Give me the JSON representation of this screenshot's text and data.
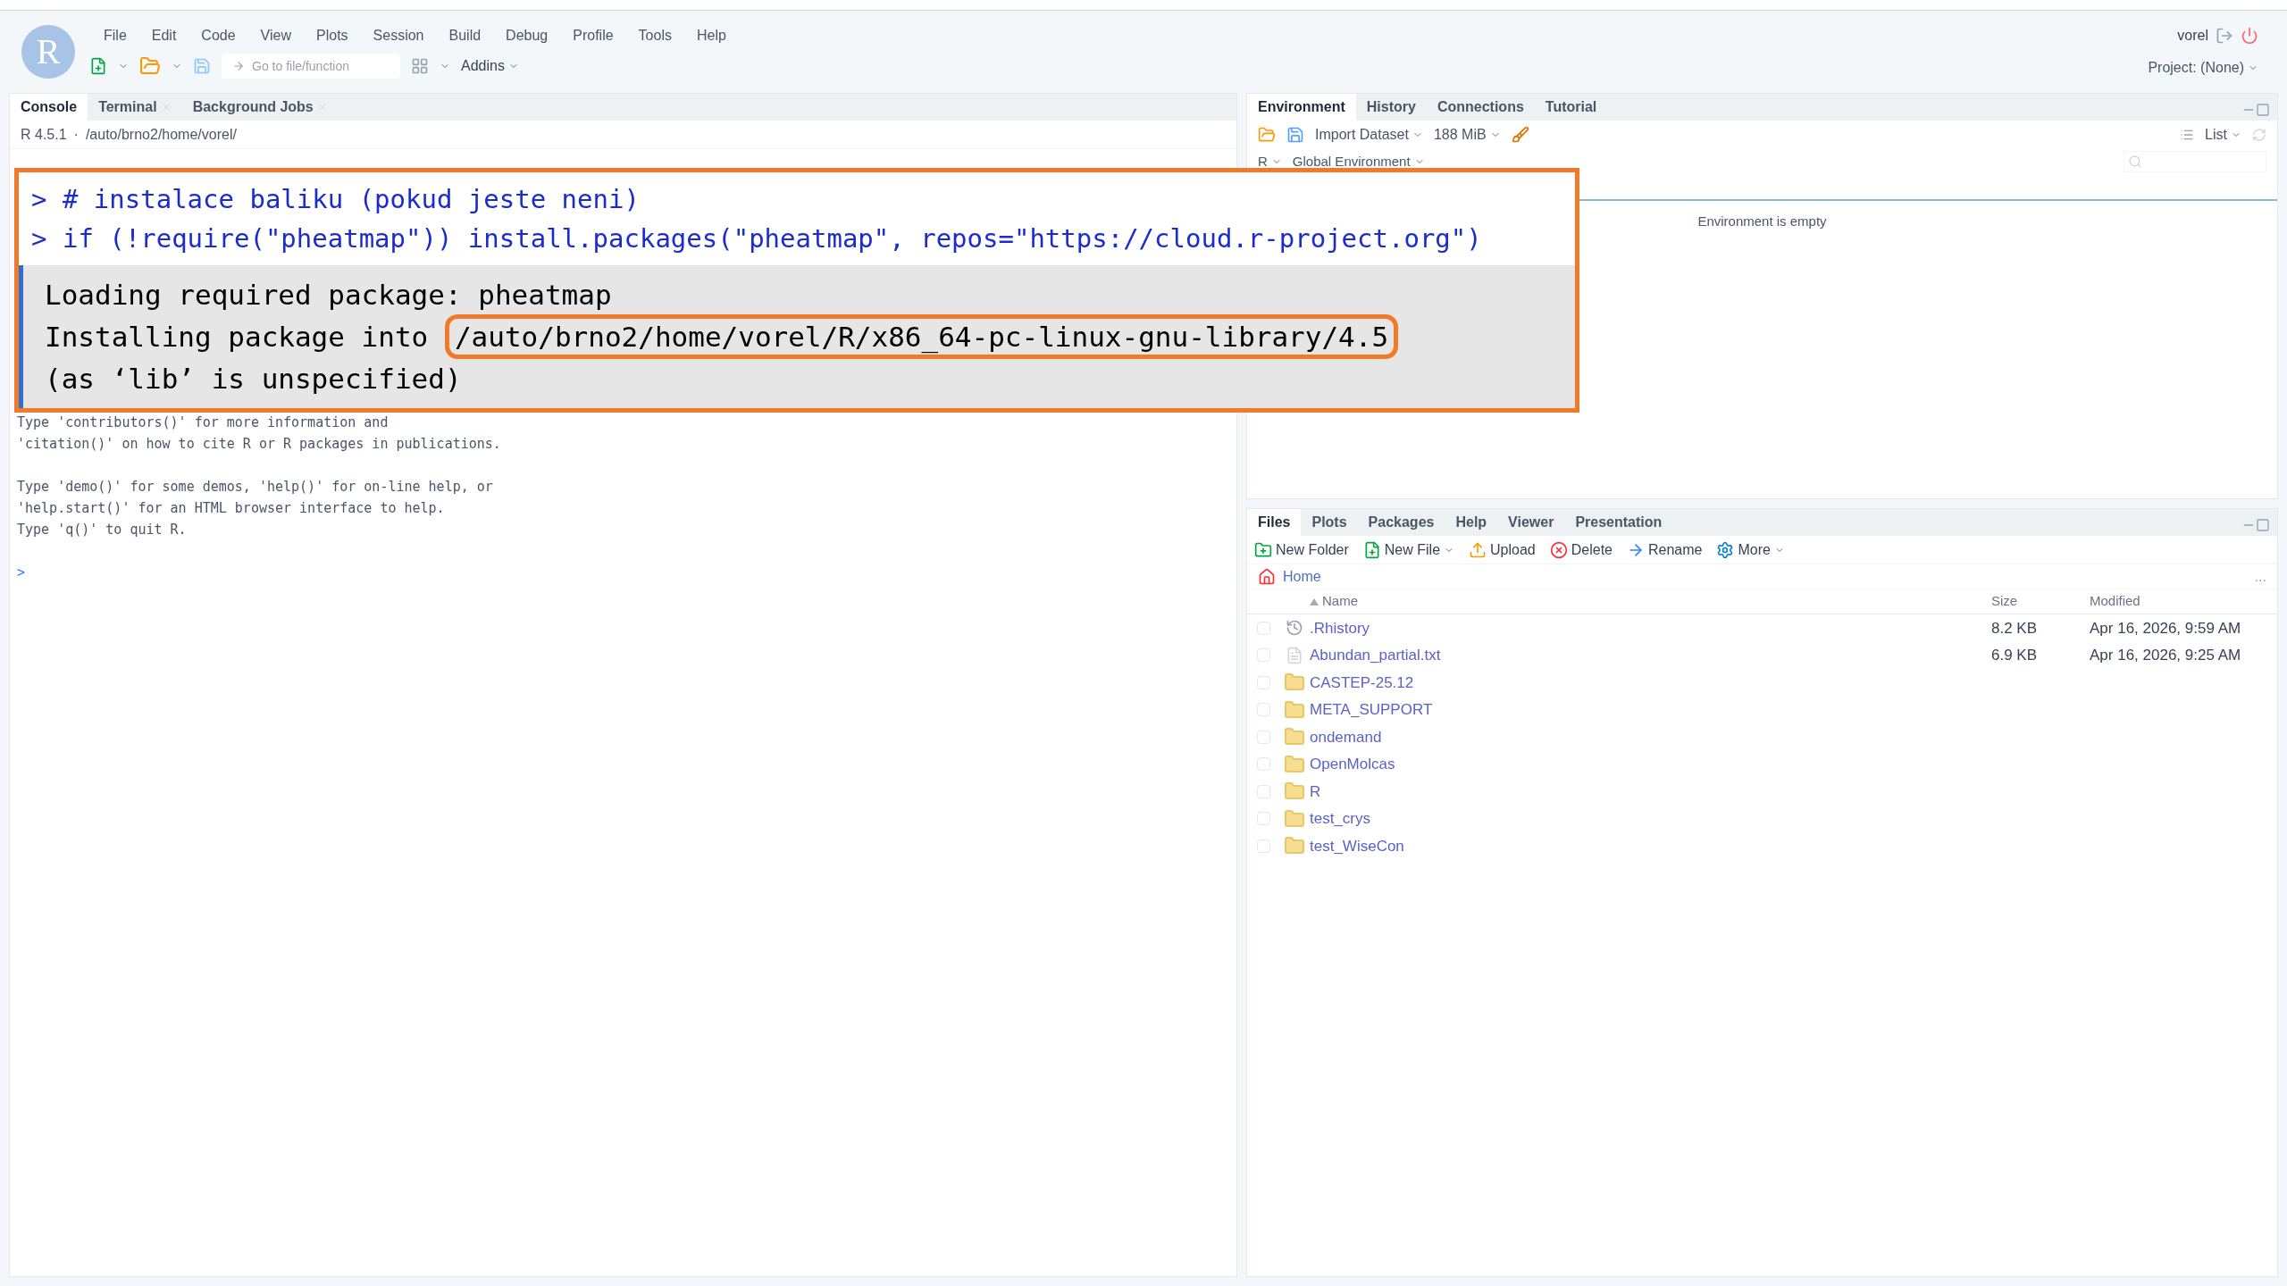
{
  "app": {
    "logo": "R",
    "menu": [
      "File",
      "Edit",
      "Code",
      "View",
      "Plots",
      "Session",
      "Build",
      "Debug",
      "Profile",
      "Tools",
      "Help"
    ],
    "goto_placeholder": "Go to file/function",
    "addins": "Addins",
    "user": "vorel",
    "project": "Project: (None)"
  },
  "console_pane": {
    "tabs": [
      {
        "label": "Console",
        "selected": true,
        "closable": false
      },
      {
        "label": "Terminal",
        "selected": false,
        "closable": true
      },
      {
        "label": "Background Jobs",
        "selected": false,
        "closable": true
      }
    ],
    "version": "R 4.5.1",
    "separator": "·",
    "path": "/auto/brno2/home/vorel/",
    "line_groups": [
      [
        "Type 'contributors()' for more information and",
        "'citation()' on how to cite R or R packages in publications."
      ],
      [
        "Type 'demo()' for some demos, 'help()' for on-line help, or",
        "'help.start()' for an HTML browser interface to help.",
        "Type 'q()' to quit R."
      ]
    ],
    "prompt": ">"
  },
  "environment_pane": {
    "tabs": [
      {
        "label": "Environment",
        "selected": true
      },
      {
        "label": "History",
        "selected": false
      },
      {
        "label": "Connections",
        "selected": false
      },
      {
        "label": "Tutorial",
        "selected": false
      }
    ],
    "import": "Import Dataset",
    "memory": "188 MiB",
    "view": "List",
    "language": "R",
    "scope": "Global Environment",
    "empty_message": "Environment is empty"
  },
  "files_pane": {
    "tabs": [
      {
        "label": "Files",
        "selected": true
      },
      {
        "label": "Plots",
        "selected": false
      },
      {
        "label": "Packages",
        "selected": false
      },
      {
        "label": "Help",
        "selected": false
      },
      {
        "label": "Viewer",
        "selected": false
      },
      {
        "label": "Presentation",
        "selected": false
      }
    ],
    "actions": [
      {
        "label": "New Folder",
        "kind": "folder",
        "dropdown": false
      },
      {
        "label": "New File",
        "kind": "file",
        "dropdown": true
      },
      {
        "label": "Upload",
        "kind": "upload",
        "dropdown": false
      },
      {
        "label": "Delete",
        "kind": "delete",
        "dropdown": false
      },
      {
        "label": "Rename",
        "kind": "rename",
        "dropdown": false
      },
      {
        "label": "More",
        "kind": "gear",
        "dropdown": true
      }
    ],
    "breadcrumb": "Home",
    "more": "...",
    "columns": [
      "Name",
      "Size",
      "Modified"
    ],
    "rows": [
      {
        "name": ".Rhistory",
        "kind": "history",
        "size": "8.2 KB",
        "modified": "Apr 16, 2026, 9:59 AM",
        "checked": false
      },
      {
        "name": "Abundan_partial.txt",
        "kind": "file",
        "size": "6.9 KB",
        "modified": "Apr 16, 2026, 9:25 AM",
        "checked": false
      },
      {
        "name": "CASTEP-25.12",
        "kind": "folder",
        "checked": false
      },
      {
        "name": "META_SUPPORT",
        "kind": "folder",
        "checked": false
      },
      {
        "name": "ondemand",
        "kind": "folder",
        "checked": false
      },
      {
        "name": "OpenMolcas",
        "kind": "folder",
        "checked": false
      },
      {
        "name": "R",
        "kind": "folder",
        "checked": false
      },
      {
        "name": "test_crys",
        "kind": "folder",
        "checked": false
      },
      {
        "name": "test_WiseCon",
        "kind": "folder",
        "checked": false
      }
    ]
  },
  "callout": {
    "commands": [
      "> # instalace baliku (pokud jeste neni)",
      "> if (!require(\"pheatmap\")) install.packages(\"pheatmap\", repos=\"https://cloud.r-project.org\")"
    ],
    "output": [
      {
        "text": "Loading required package: pheatmap"
      },
      {
        "text": "Installing package into ",
        "highlight": "/auto/brno2/home/vorel/R/x86_64-pc-linux-gnu-library/4.5"
      },
      {
        "text": "(as ‘lib’ is unspecified)"
      }
    ]
  }
}
